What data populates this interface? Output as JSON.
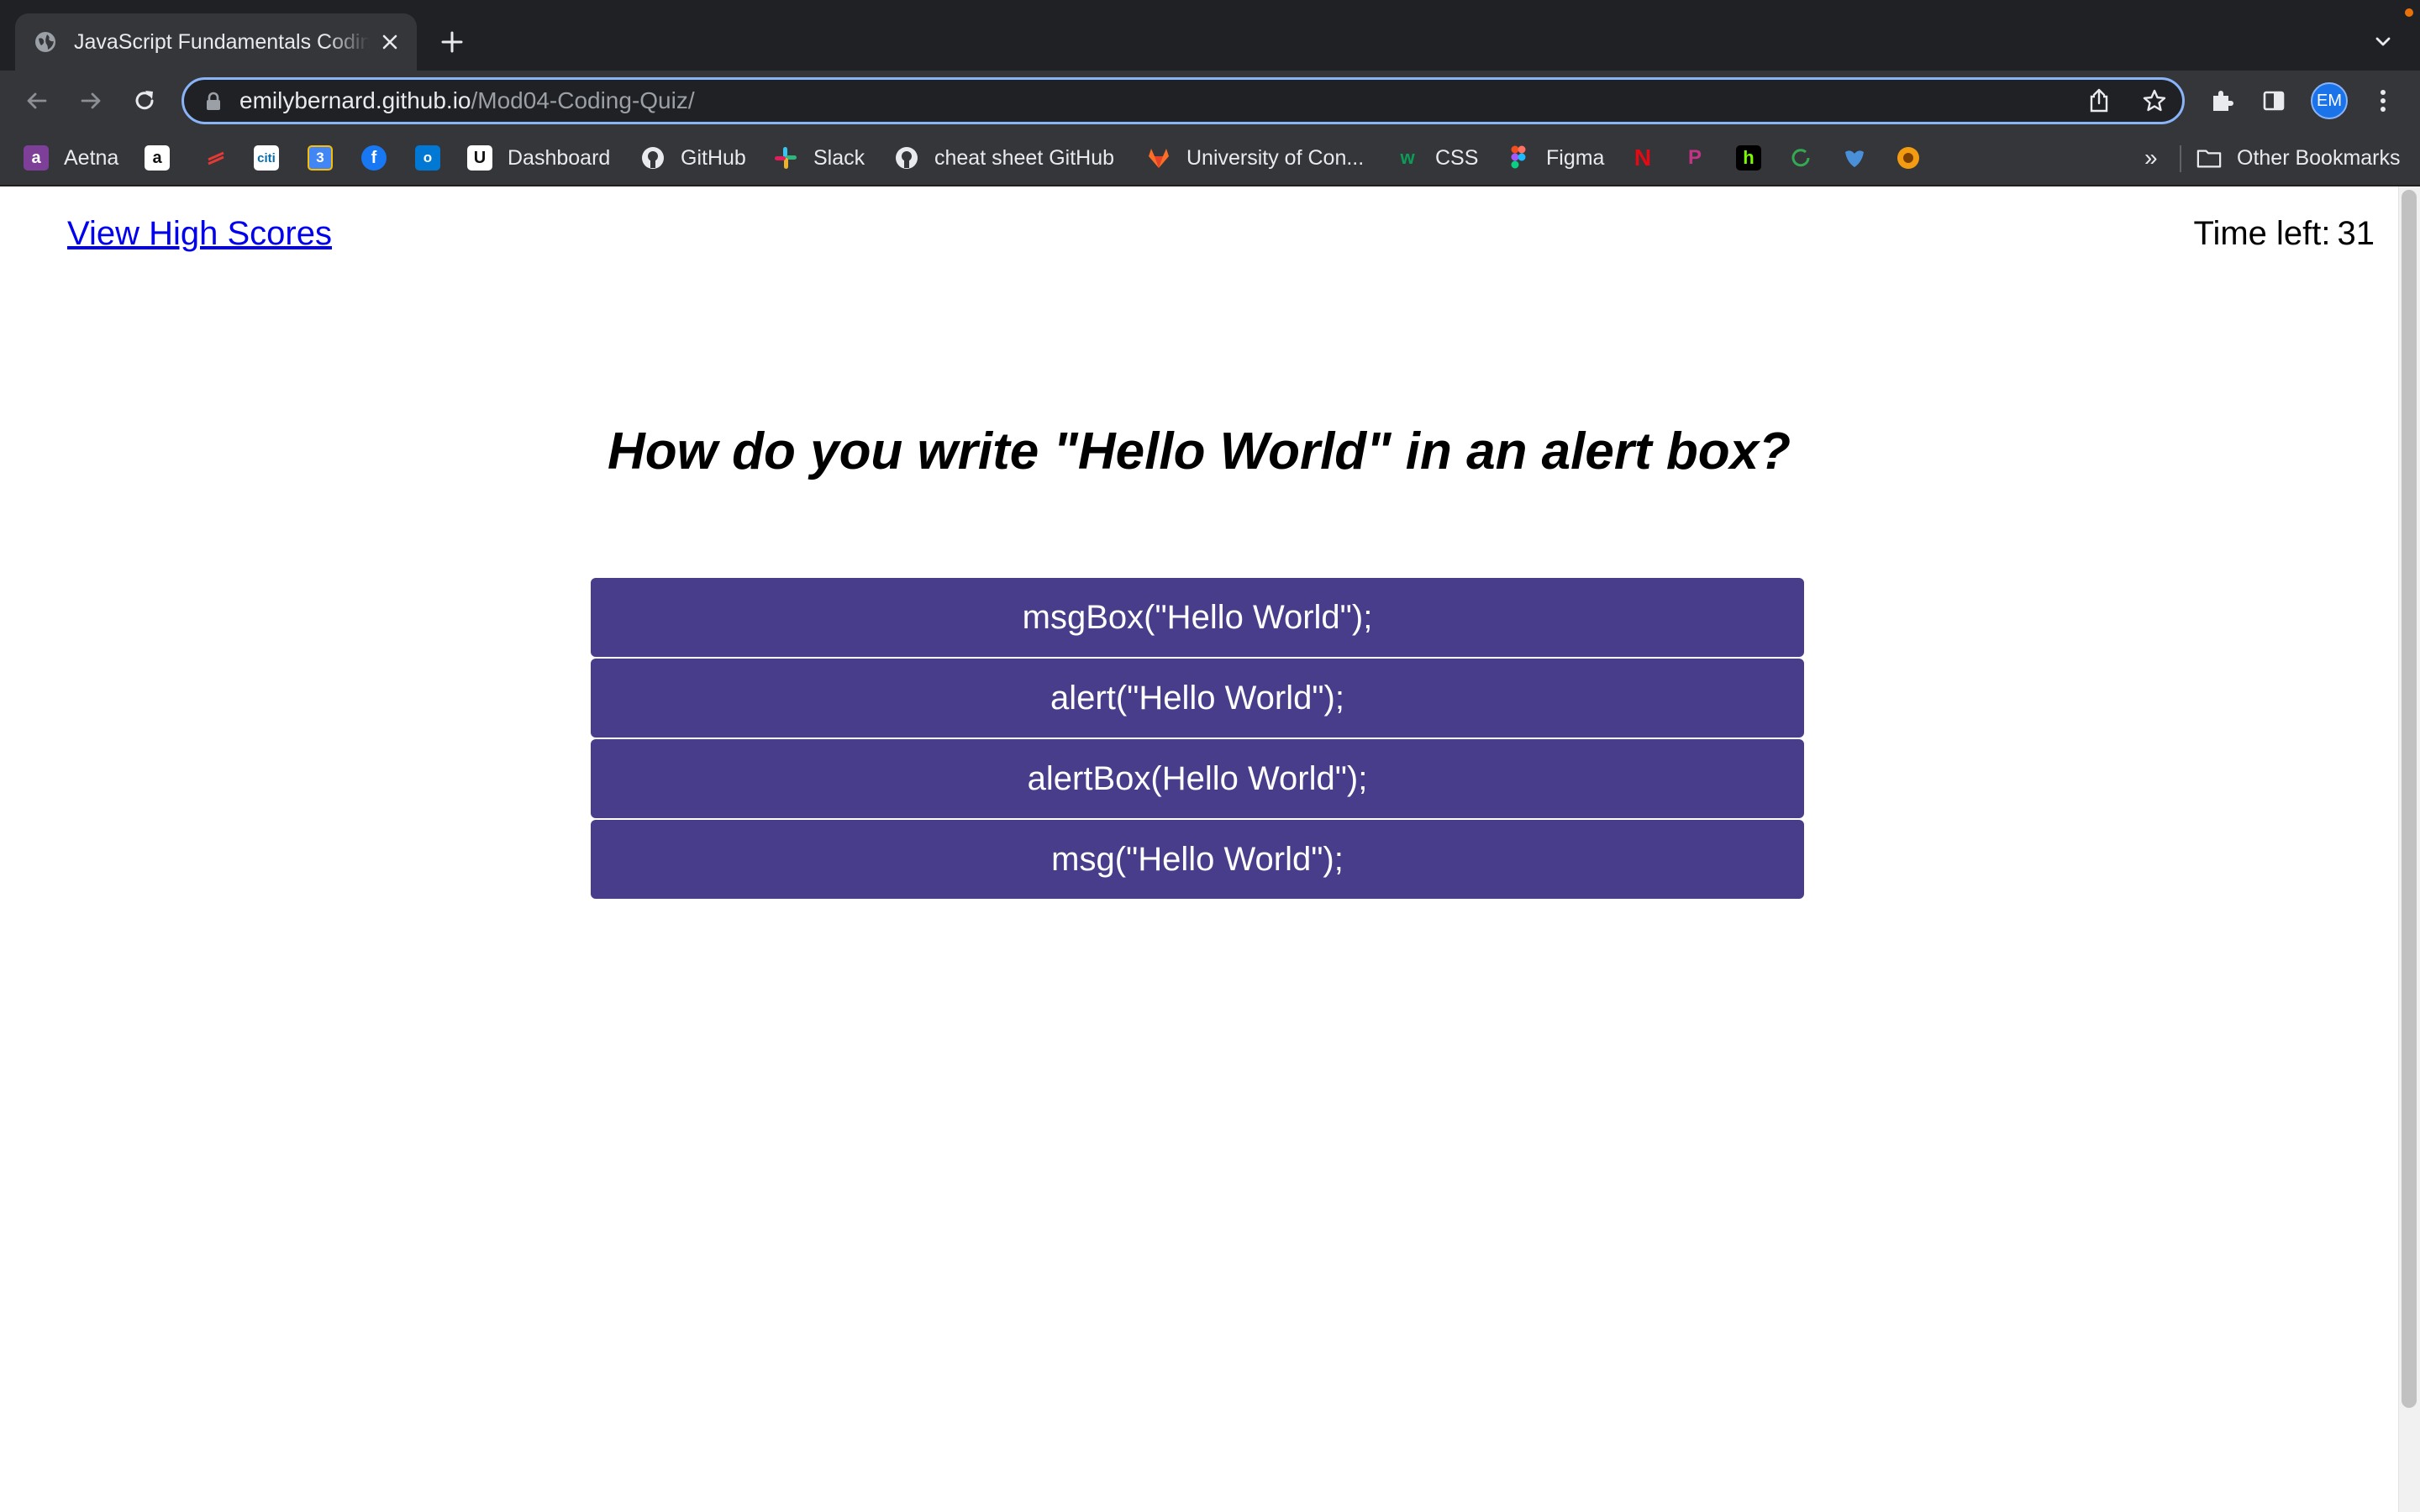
{
  "browser": {
    "tab_title": "JavaScript Fundamentals Coding Quiz",
    "url_domain": "emilybernard.github.io",
    "url_path": "/Mod04-Coding-Quiz/",
    "profile_initials": "EM",
    "accent_color": "#8ab4f8",
    "bookmarks": [
      {
        "label": "Aetna",
        "icon": "aetna-icon"
      },
      {
        "label": "",
        "icon": "amazon-icon"
      },
      {
        "label": "",
        "icon": "red-arrows-icon"
      },
      {
        "label": "",
        "icon": "citi-icon"
      },
      {
        "label": "",
        "icon": "calendar-icon"
      },
      {
        "label": "",
        "icon": "facebook-icon"
      },
      {
        "label": "",
        "icon": "outlook-icon"
      },
      {
        "label": "Dashboard",
        "icon": "dashboard-icon"
      },
      {
        "label": "GitHub",
        "icon": "github-icon"
      },
      {
        "label": "Slack",
        "icon": "slack-icon"
      },
      {
        "label": "cheat sheet GitHub",
        "icon": "github-icon"
      },
      {
        "label": "University of Con...",
        "icon": "gitlab-icon"
      },
      {
        "label": "CSS",
        "icon": "w-icon"
      },
      {
        "label": "Figma",
        "icon": "figma-icon"
      },
      {
        "label": "",
        "icon": "netflix-icon"
      },
      {
        "label": "",
        "icon": "p-icon"
      },
      {
        "label": "",
        "icon": "h-icon"
      },
      {
        "label": "",
        "icon": "refresh-green-icon"
      },
      {
        "label": "",
        "icon": "blue-bird-icon"
      },
      {
        "label": "",
        "icon": "sunflower-icon"
      }
    ],
    "overflow_label": "»",
    "other_bookmarks": "Other Bookmarks"
  },
  "page": {
    "high_scores_link": "View High Scores",
    "timer_label": "Time left:",
    "timer_value": "31",
    "question": "How do you write \"Hello World\" in an alert box?",
    "answers": [
      "msgBox(\"Hello World\");",
      "alert(\"Hello World\");",
      "alertBox(Hello World\");",
      "msg(\"Hello World\");"
    ],
    "answer_color": "#483d8b"
  }
}
